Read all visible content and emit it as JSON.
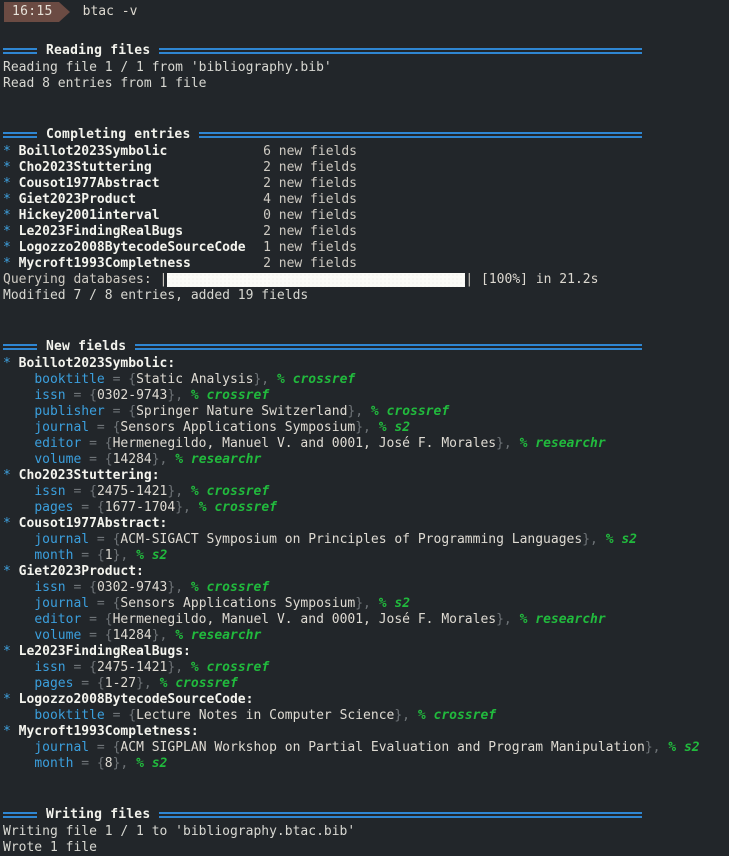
{
  "prompt": {
    "time": "16:15",
    "command": "btac -v"
  },
  "sections": {
    "reading": {
      "title": "Reading files",
      "lines": [
        "Reading file 1 / 1 from 'bibliography.bib'",
        "Read 8 entries from 1 file"
      ]
    },
    "completing": {
      "title": "Completing entries",
      "entries": [
        {
          "star": "*",
          "name": "Boillot2023Symbolic",
          "count": "6 new fields"
        },
        {
          "star": "*",
          "name": "Cho2023Stuttering",
          "count": "2 new fields"
        },
        {
          "star": "*",
          "name": "Cousot1977Abstract",
          "count": "2 new fields"
        },
        {
          "star": "*",
          "name": "Giet2023Product",
          "count": "4 new fields"
        },
        {
          "star": "*",
          "name": "Hickey2001interval",
          "count": "0 new fields"
        },
        {
          "star": "*",
          "name": "Le2023FindingRealBugs",
          "count": "2 new fields"
        },
        {
          "star": "*",
          "name": "Logozzo2008BytecodeSourceCode",
          "count": "1 new fields"
        },
        {
          "star": "*",
          "name": "Mycroft1993Completness",
          "count": "2 new fields"
        }
      ],
      "progress": {
        "label": "Querying databases: ",
        "left_bracket": "|",
        "right_bracket": "|",
        "percent_text": " [100%] in 21.2s",
        "percent": 100
      },
      "summary": "Modified 7 / 8 entries, added 19 fields"
    },
    "newfields": {
      "title": "New fields",
      "groups": [
        {
          "star": "*",
          "name": "Boillot2023Symbolic:",
          "fields": [
            {
              "key": "booktitle",
              "value": "Static Analysis",
              "note": "% crossref"
            },
            {
              "key": "issn",
              "value": "0302-9743",
              "note": "% crossref"
            },
            {
              "key": "publisher",
              "value": "Springer Nature Switzerland",
              "note": "% crossref"
            },
            {
              "key": "journal",
              "value": "Sensors Applications Symposium",
              "note": "% s2"
            },
            {
              "key": "editor",
              "value": "Hermenegildo, Manuel V. and 0001, José F. Morales",
              "note": "% researchr"
            },
            {
              "key": "volume",
              "value": "14284",
              "note": "% researchr"
            }
          ]
        },
        {
          "star": "*",
          "name": "Cho2023Stuttering:",
          "fields": [
            {
              "key": "issn",
              "value": "2475-1421",
              "note": "% crossref"
            },
            {
              "key": "pages",
              "value": "1677-1704",
              "note": "% crossref"
            }
          ]
        },
        {
          "star": "*",
          "name": "Cousot1977Abstract:",
          "fields": [
            {
              "key": "journal",
              "value": "ACM-SIGACT Symposium on Principles of Programming Languages",
              "note": "% s2"
            },
            {
              "key": "month",
              "value": "1",
              "note": "% s2"
            }
          ]
        },
        {
          "star": "*",
          "name": "Giet2023Product:",
          "fields": [
            {
              "key": "issn",
              "value": "0302-9743",
              "note": "% crossref"
            },
            {
              "key": "journal",
              "value": "Sensors Applications Symposium",
              "note": "% s2"
            },
            {
              "key": "editor",
              "value": "Hermenegildo, Manuel V. and 0001, José F. Morales",
              "note": "% researchr"
            },
            {
              "key": "volume",
              "value": "14284",
              "note": "% researchr"
            }
          ]
        },
        {
          "star": "*",
          "name": "Le2023FindingRealBugs:",
          "fields": [
            {
              "key": "issn",
              "value": "2475-1421",
              "note": "% crossref"
            },
            {
              "key": "pages",
              "value": "1-27",
              "note": "% crossref"
            }
          ]
        },
        {
          "star": "*",
          "name": "Logozzo2008BytecodeSourceCode:",
          "fields": [
            {
              "key": "booktitle",
              "value": "Lecture Notes in Computer Science",
              "note": "% crossref"
            }
          ]
        },
        {
          "star": "*",
          "name": "Mycroft1993Completness:",
          "fields": [
            {
              "key": "journal",
              "value": "ACM SIGPLAN Workshop on Partial Evaluation and Program Manipulation",
              "note": "% s2"
            },
            {
              "key": "month",
              "value": "8",
              "note": "% s2"
            }
          ]
        }
      ]
    },
    "writing": {
      "title": "Writing files",
      "lines": [
        "Writing file 1 / 1 to 'bibliography.btac.bib'",
        "Wrote 1 file"
      ]
    }
  },
  "colors": {
    "background": "#22262a",
    "rule": "#2f86d2",
    "key": "#3b9fdd",
    "note": "#21ba3d",
    "prompt_bg": "#6b4b43",
    "text": "#dcd8d0"
  }
}
